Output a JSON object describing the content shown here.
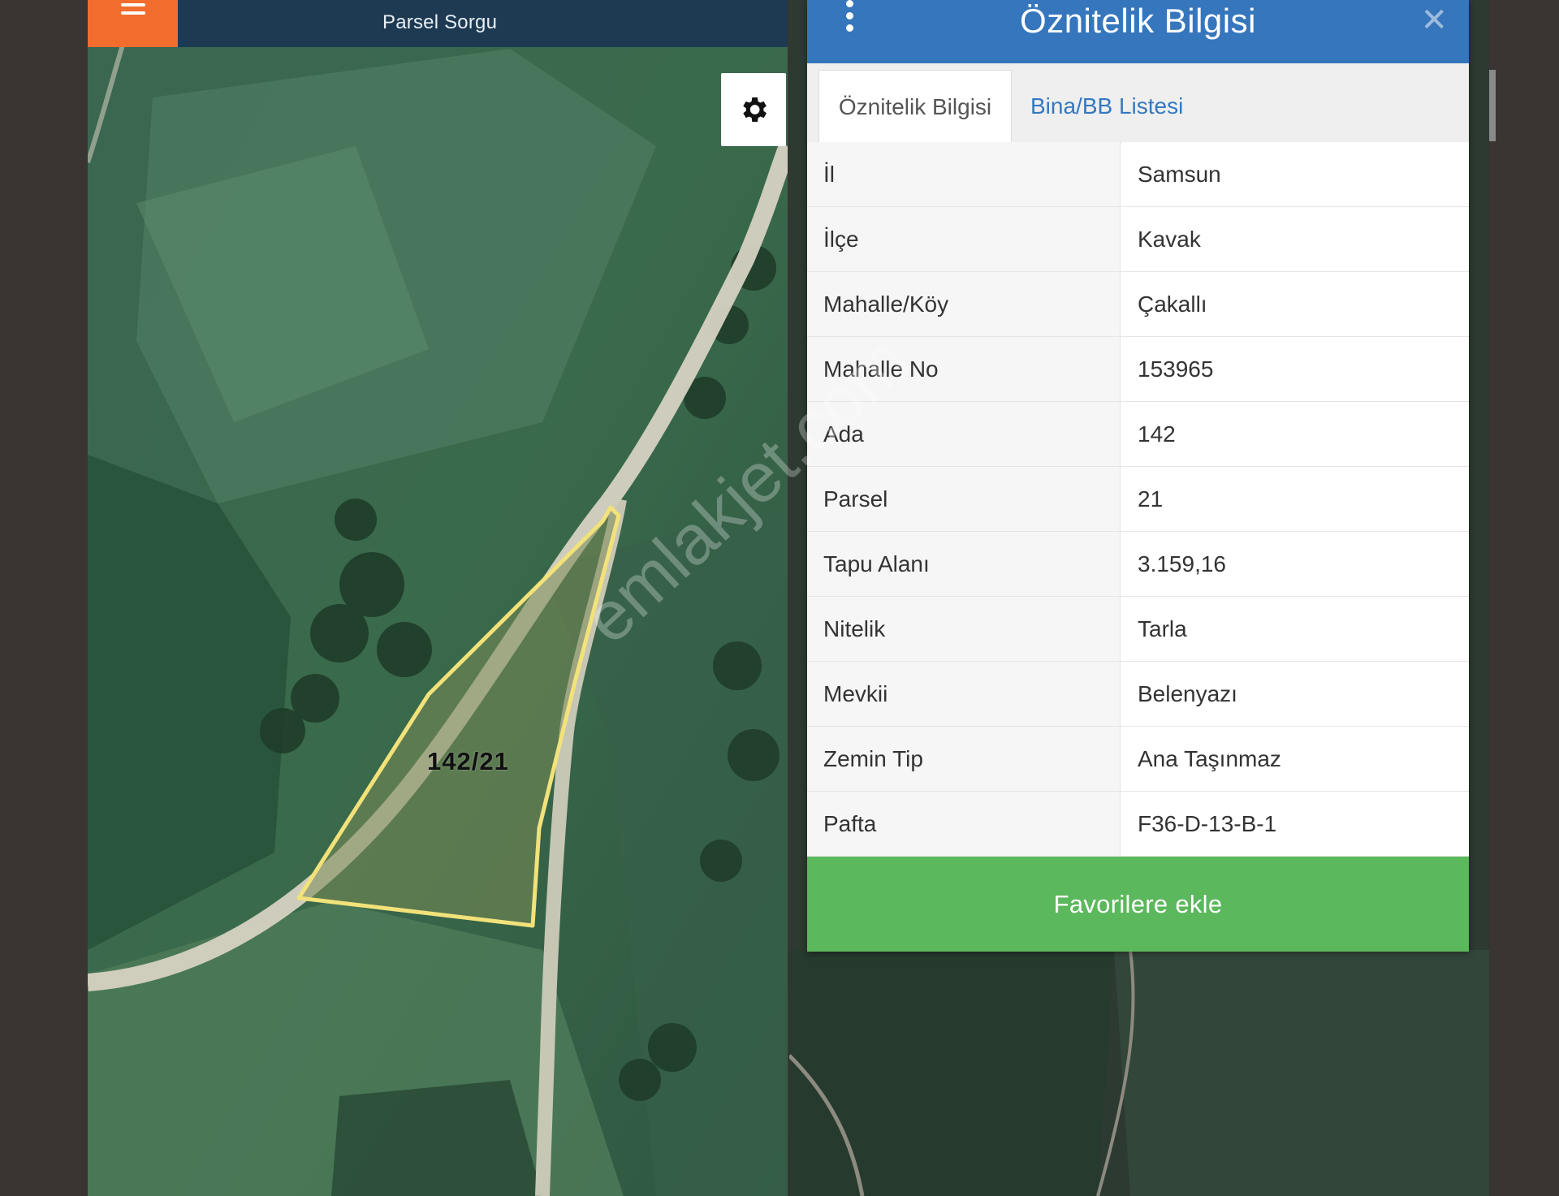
{
  "left": {
    "title": "Parsel Sorgu",
    "menu_icon": "hamburger-icon",
    "settings_icon": "gear-icon",
    "parcel_label": "142/21"
  },
  "dialog": {
    "title": "Öznitelik Bilgisi",
    "tabs": [
      {
        "label": "Öznitelik Bilgisi",
        "active": true
      },
      {
        "label": "Bina/BB Listesi",
        "active": false
      }
    ],
    "rows": [
      {
        "key": "İl",
        "value": "Samsun"
      },
      {
        "key": "İlçe",
        "value": "Kavak"
      },
      {
        "key": "Mahalle/Köy",
        "value": "Çakallı"
      },
      {
        "key": "Mahalle No",
        "value": "153965"
      },
      {
        "key": "Ada",
        "value": "142"
      },
      {
        "key": "Parsel",
        "value": "21"
      },
      {
        "key": "Tapu Alanı",
        "value": "3.159,16"
      },
      {
        "key": "Nitelik",
        "value": "Tarla"
      },
      {
        "key": "Mevkii",
        "value": "Belenyazı"
      },
      {
        "key": "Zemin Tip",
        "value": "Ana Taşınmaz"
      },
      {
        "key": "Pafta",
        "value": "F36-D-13-B-1"
      }
    ],
    "favorite_button": "Favorilere ekle",
    "menu_icon": "kebab-menu-icon",
    "close_icon": "close-icon"
  },
  "watermark": "emlakjet.com",
  "colors": {
    "header_orange": "#f26d2d",
    "header_dark": "#1d3a52",
    "dialog_blue": "#3676bd",
    "tab_link_blue": "#3478c0",
    "button_green": "#5cb85c",
    "parcel_outline": "#f2e27a"
  }
}
